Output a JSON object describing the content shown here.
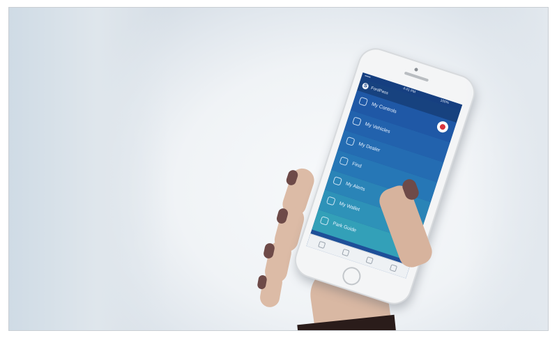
{
  "app": {
    "status_carrier": "•••••",
    "status_time": "4:41 PM",
    "status_battery": "100%",
    "title": "FordPass",
    "logo_letter": "S"
  },
  "menu": {
    "items": [
      {
        "label": "My Controls",
        "color": "#1f58a6"
      },
      {
        "label": "My Vehicles",
        "color": "#2262ad"
      },
      {
        "label": "My Dealer",
        "color": "#246cb2"
      },
      {
        "label": "Find",
        "color": "#2677b6"
      },
      {
        "label": "My Alerts",
        "color": "#2a84b7"
      },
      {
        "label": "My Wallet",
        "color": "#2e92b8"
      },
      {
        "label": "Park Guide",
        "color": "#33a0b8"
      }
    ]
  },
  "tabs": [
    "home-icon",
    "map-icon",
    "pin-icon",
    "user-icon"
  ]
}
